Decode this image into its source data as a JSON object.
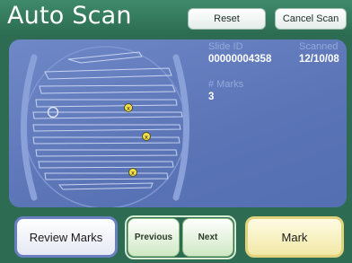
{
  "header": {
    "title": "Auto Scan",
    "reset_label": "Reset",
    "cancel_label": "Cancel Scan"
  },
  "slide_info": {
    "slide_id_label": "Slide ID",
    "slide_id_value": "00000004358",
    "scanned_label": "Scanned",
    "scanned_value": "12/10/08",
    "marks_label": "# Marks",
    "marks_value": "3"
  },
  "footer": {
    "review_label": "Review Marks",
    "previous_label": "Previous",
    "next_label": "Next",
    "mark_label": "Mark"
  },
  "colors": {
    "header_bg": "#2b6b50",
    "panel_bg": "#5a74b6",
    "mark_dot": "#f4e04a",
    "review_border": "#6a7fc2",
    "mark_border": "#e2d27b"
  }
}
